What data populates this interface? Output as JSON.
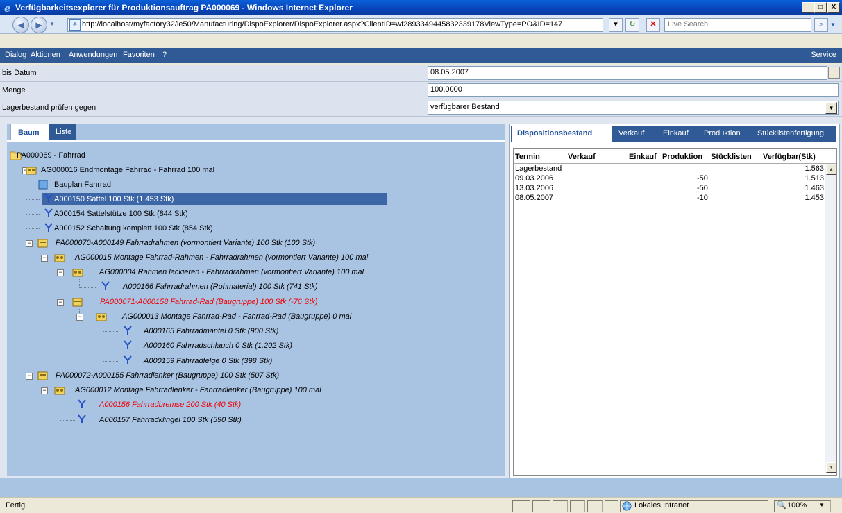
{
  "window": {
    "title": "Verfügbarkeitsexplorer für Produktionsauftrag PA000069 - Windows Internet Explorer",
    "minimize": "_",
    "maximize": "□",
    "close": "X"
  },
  "browser": {
    "url": "http://localhost/myfactory32/ie50/Manufacturing/DispoExplorer/DispoExplorer.aspx?ClientID=wf2893349445832339178ViewType=PO&ID=147",
    "search_placeholder": "Live Search"
  },
  "menu": {
    "items": [
      "Dialog",
      "Aktionen",
      "Anwendungen",
      "Favoriten",
      "?"
    ],
    "service": "Service"
  },
  "form": {
    "date_label": "bis Datum",
    "date_value": "08.05.2007",
    "date_btn": "...",
    "qty_label": "Menge",
    "qty_value": "100,0000",
    "stock_label": "Lagerbestand prüfen gegen",
    "stock_value": "verfügbarer Bestand"
  },
  "tree_tabs": [
    "Baum",
    "Liste"
  ],
  "tree": [
    {
      "text": "PA000069 - Fahrrad"
    },
    {
      "text": "AG000016 Endmontage Fahrrad - Fahrrad 100 mal"
    },
    {
      "text": "Bauplan Fahrrad"
    },
    {
      "text": "A000150 Sattel 100 Stk (1.453 Stk)"
    },
    {
      "text": "A000154 Sattelstütze 100 Stk (844 Stk)"
    },
    {
      "text": "A000152 Schaltung komplett 100 Stk (854 Stk)"
    },
    {
      "text": "PA000070-A000149 Fahrradrahmen (vormontiert Variante) 100 Stk (100 Stk)"
    },
    {
      "text": "AG000015 Montage Fahrrad-Rahmen - Fahrradrahmen (vormontiert Variante) 100 mal"
    },
    {
      "text": "AG000004 Rahmen lackieren - Fahrradrahmen (vormontiert Variante) 100 mal"
    },
    {
      "text": "A000166 Fahrradrahmen (Rohmaterial) 100 Stk (741 Stk)"
    },
    {
      "text": "PA000071-A000158 Fahrrad-Rad (Baugruppe) 100 Stk (-76 Stk)"
    },
    {
      "text": "AG000013 Montage Fahrrad-Rad - Fahrrad-Rad (Baugruppe) 0 mal"
    },
    {
      "text": "A000165 Fahrradmantel 0 Stk (900 Stk)"
    },
    {
      "text": "A000160 Fahrradschlauch 0 Stk (1.202 Stk)"
    },
    {
      "text": "A000159 Fahrradfelge 0 Stk (398 Stk)"
    },
    {
      "text": "PA000072-A000155 Fahrradlenker (Baugruppe) 100 Stk (507 Stk)"
    },
    {
      "text": "AG000012 Montage Fahrradlenker - Fahrradlenker (Baugruppe) 100 mal"
    },
    {
      "text": "A000156 Fahrradbremse 200 Stk (40 Stk)"
    },
    {
      "text": "A000157 Fahrradklingel 100 Stk (590 Stk)"
    }
  ],
  "right_tabs": [
    "Dispositionsbestand",
    "Verkauf",
    "Einkauf",
    "Produktion",
    "Stücklistenfertigung"
  ],
  "grid": {
    "headers": [
      "Termin",
      "Verkauf",
      "Einkauf",
      "Produktion",
      "Stücklisten",
      "Verfügbar(Stk)"
    ],
    "rows": [
      {
        "termin": "Lagerbestand",
        "produktion": "",
        "verfuegbar": "1.563"
      },
      {
        "termin": "09.03.2006",
        "produktion": "-50",
        "verfuegbar": "1.513"
      },
      {
        "termin": "13.03.2006",
        "produktion": "-50",
        "verfuegbar": "1.463"
      },
      {
        "termin": "08.05.2007",
        "produktion": "-10",
        "verfuegbar": "1.453"
      }
    ]
  },
  "status": {
    "text": "Fertig",
    "zone": "Lokales Intranet",
    "zoom": "100%"
  },
  "colors": {
    "menu_bg": "#2f5a95",
    "tree_bg": "#a9c3e3",
    "selection": "#3d66a7",
    "error_text": "#ee0000"
  }
}
